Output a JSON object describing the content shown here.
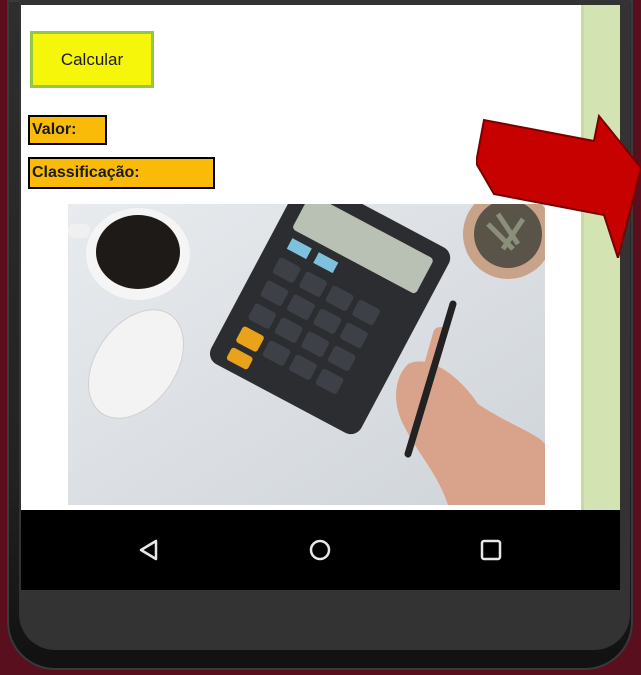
{
  "app": {
    "calculate_button": "Calcular",
    "value_label": "Valor:",
    "classification_label": "Classificação:"
  },
  "photo": {
    "description_icons": [
      "coffee-cup-icon",
      "mouse-icon",
      "calculator-icon",
      "hand-icon",
      "plant-icon"
    ]
  },
  "navigation": {
    "buttons": [
      "back-icon",
      "home-icon",
      "recent-apps-icon"
    ]
  },
  "colors": {
    "calculate_button_bg": "#f6f60a",
    "calculate_button_border": "#95c646",
    "label_bg": "#f9bb07",
    "side_strip": "#d3e3b2",
    "background": "#5a0f1e",
    "arrow": "#c70000"
  }
}
